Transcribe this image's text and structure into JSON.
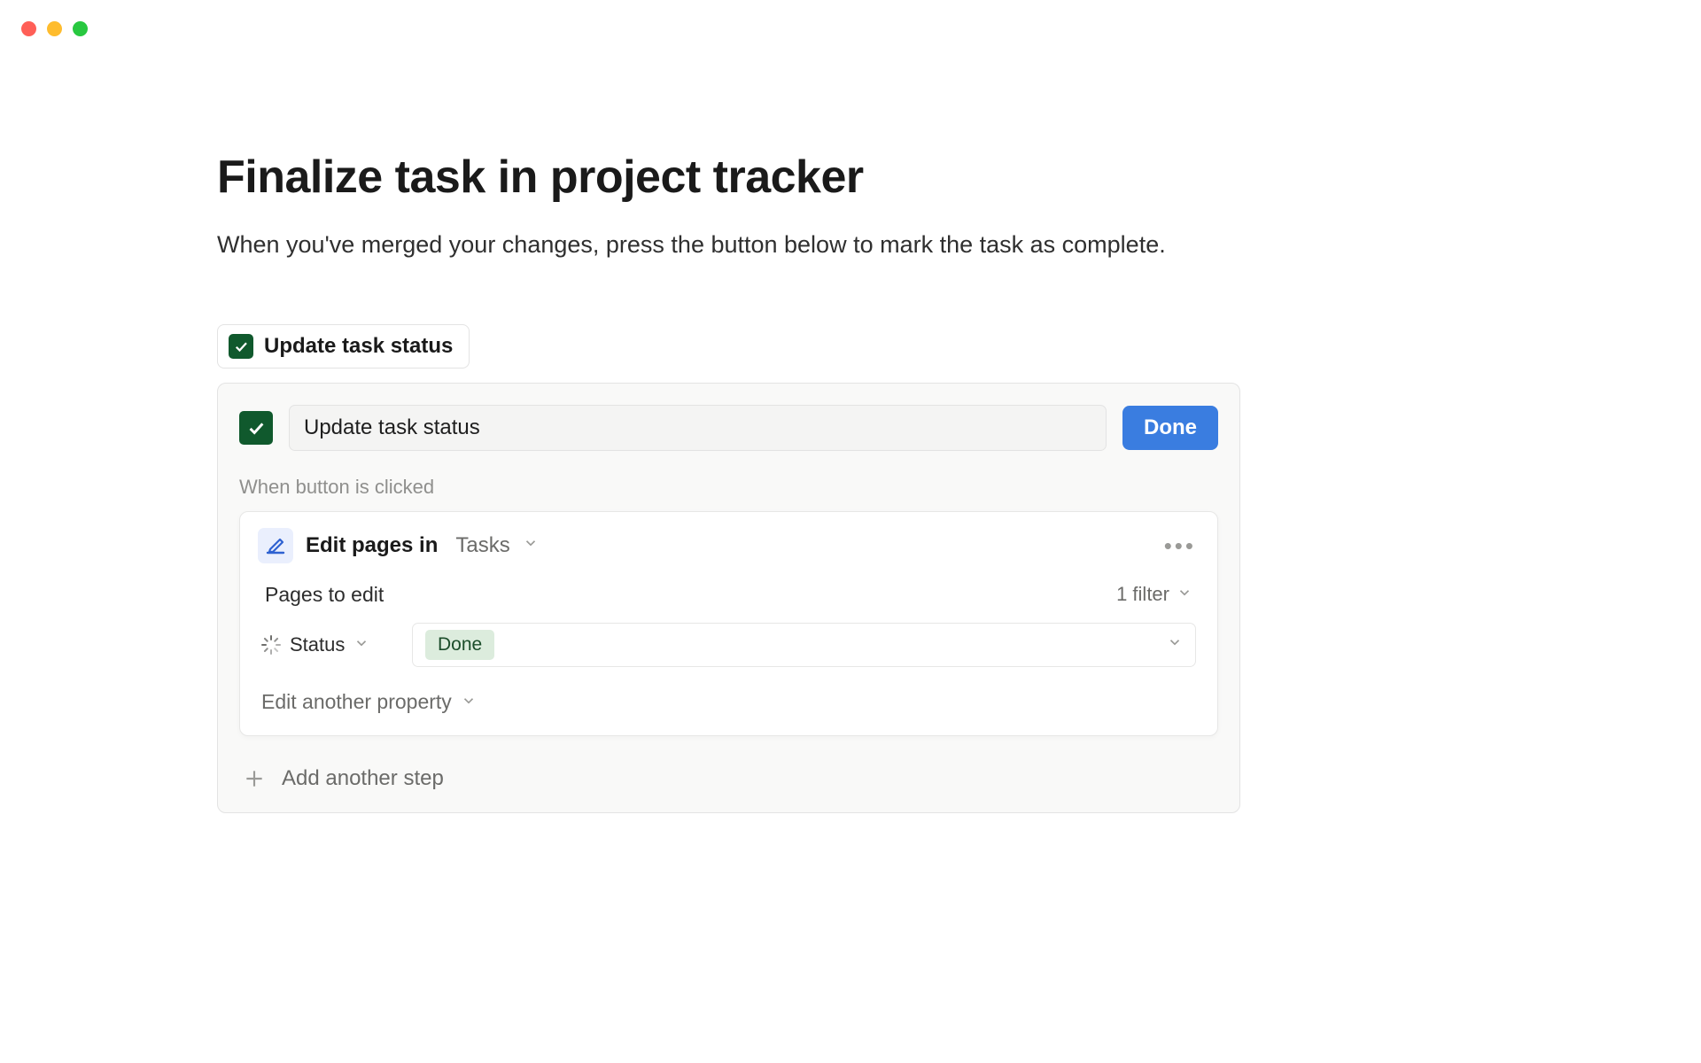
{
  "page": {
    "title": "Finalize task in project tracker",
    "subtitle": "When you've merged your changes, press the button below to mark the task as complete."
  },
  "chip": {
    "label": "Update task status"
  },
  "editor": {
    "name_value": "Update task status",
    "done_label": "Done",
    "trigger_text": "When button is clicked",
    "step": {
      "action_label": "Edit pages in",
      "target_db": "Tasks",
      "pages_label": "Pages to edit",
      "filter_summary": "1 filter",
      "property": {
        "name": "Status",
        "value": "Done"
      },
      "edit_another_label": "Edit another property"
    },
    "add_step_label": "Add another step"
  }
}
